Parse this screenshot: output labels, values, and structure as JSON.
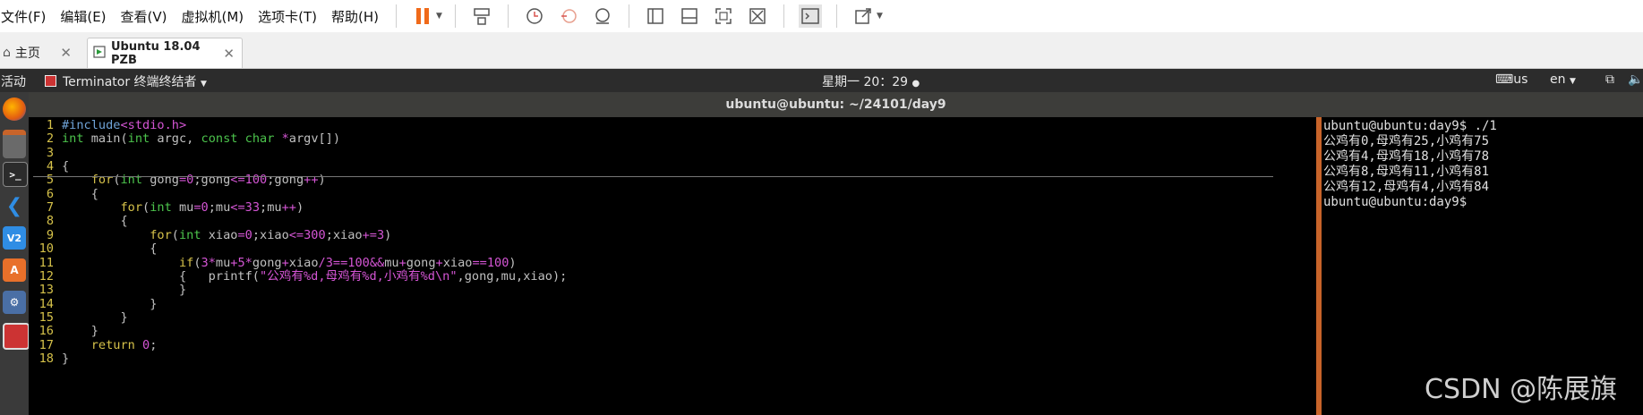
{
  "vm_menu": [
    "文件(F)",
    "编辑(E)",
    "查看(V)",
    "虚拟机(M)",
    "选项卡(T)",
    "帮助(H)"
  ],
  "vm_toolbar_icons": [
    "pause-icon",
    "send-keys-icon",
    "snapshot-icon",
    "revert-snapshot-icon",
    "snapshot-manager-icon",
    "sidebar-view-icon",
    "console-view-icon",
    "fullscreen-icon",
    "unity-icon",
    "terminal-icon",
    "stretch-icon"
  ],
  "tabs": [
    {
      "label": "主页",
      "icon": "home-icon"
    },
    {
      "label": "Ubuntu 18.04 PZB",
      "icon": "vm-icon",
      "active": true
    }
  ],
  "gnome": {
    "activities": "活动",
    "app_menu": "Terminator 终端终结者",
    "clock": "星期一 20：29",
    "keyboard": "us",
    "lang": "en"
  },
  "dock_icons": [
    "firefox-icon",
    "files-icon",
    "terminal-icon",
    "vscode-icon",
    "vmware-icon",
    "software-icon",
    "settings-icon",
    "terminator-icon"
  ],
  "window_title": "ubuntu@ubuntu: ~/24101/day9",
  "code_lines": [
    {
      "n": "1",
      "t": "#include<stdio.h>"
    },
    {
      "n": "2",
      "t": "int main(int argc, const char *argv[])"
    },
    {
      "n": "3",
      "t": ""
    },
    {
      "n": "4",
      "t": "{"
    },
    {
      "n": "5",
      "t": "    for(int gong=0;gong<=100;gong++)"
    },
    {
      "n": "6",
      "t": "    {"
    },
    {
      "n": "7",
      "t": "        for(int mu=0;mu<=33;mu++)"
    },
    {
      "n": "8",
      "t": "        {"
    },
    {
      "n": "9",
      "t": "            for(int xiao=0;xiao<=300;xiao+=3)"
    },
    {
      "n": "10",
      "t": "            {"
    },
    {
      "n": "11",
      "t": "                if(3*mu+5*gong+xiao/3==100&&mu+gong+xiao==100)"
    },
    {
      "n": "12",
      "t": "                {   printf(\"公鸡有%d,母鸡有%d,小鸡有%d\\n\",gong,mu,xiao);"
    },
    {
      "n": "13",
      "t": "                }"
    },
    {
      "n": "14",
      "t": "            }"
    },
    {
      "n": "15",
      "t": "        }"
    },
    {
      "n": "16",
      "t": "    }"
    },
    {
      "n": "17",
      "t": "    return 0;"
    },
    {
      "n": "18",
      "t": "}"
    }
  ],
  "terminal_lines": [
    "ubuntu@ubuntu:day9$ ./1",
    "公鸡有0,母鸡有25,小鸡有75",
    "公鸡有4,母鸡有18,小鸡有78",
    "公鸡有8,母鸡有11,小鸡有81",
    "公鸡有12,母鸡有4,小鸡有84",
    "ubuntu@ubuntu:day9$ "
  ],
  "watermark": "CSDN @陈展旗",
  "colors": {
    "splitter": "#c8642a",
    "line_numbers": "#d6c24a",
    "keyword": "#d6c24a",
    "type": "#4cc44c",
    "number": "#d455d4"
  }
}
